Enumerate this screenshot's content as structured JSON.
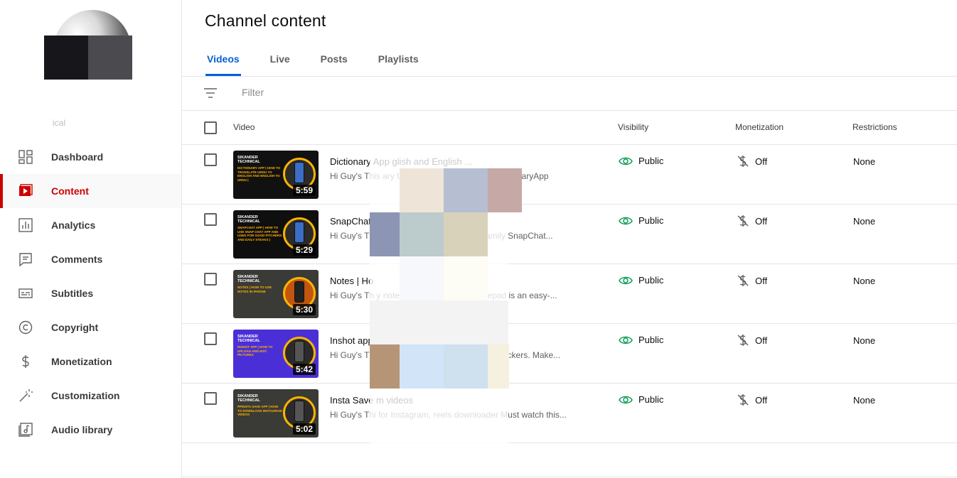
{
  "sidebar": {
    "channel_name": "ical",
    "items": [
      {
        "label": "Dashboard",
        "icon": "dashboard-icon"
      },
      {
        "label": "Content",
        "icon": "content-icon",
        "active": true
      },
      {
        "label": "Analytics",
        "icon": "analytics-icon"
      },
      {
        "label": "Comments",
        "icon": "comments-icon"
      },
      {
        "label": "Subtitles",
        "icon": "subtitles-icon"
      },
      {
        "label": "Copyright",
        "icon": "copyright-icon"
      },
      {
        "label": "Monetization",
        "icon": "dollar-icon"
      },
      {
        "label": "Customization",
        "icon": "magic-wand-icon"
      },
      {
        "label": "Audio library",
        "icon": "audio-library-icon"
      }
    ]
  },
  "main": {
    "title": "Channel content",
    "tabs": [
      {
        "label": "Videos",
        "active": true
      },
      {
        "label": "Live"
      },
      {
        "label": "Posts"
      },
      {
        "label": "Playlists"
      }
    ],
    "filter": {
      "placeholder": "Filter"
    },
    "columns": {
      "video": "Video",
      "visibility": "Visibility",
      "monetization": "Monetization",
      "restrictions": "Restrictions"
    },
    "accent_color": "#065fd4",
    "active_nav_color": "#cc0000",
    "visibility_color": "#0f9d58"
  },
  "videos": [
    {
      "title": "Dictionary App glish and English ...",
      "description": "Hi Guy's This ary Urdu to English & English to nionaryApp",
      "duration": "5:59",
      "thumb_brand": "SIKANDER TECHNICAL",
      "thumb_text": "DICTIONARY APP | HOW TO TRANSLATE URDU TO ENGLISH AND ENGLISH TO URDU |",
      "visibility": "Public",
      "monetization": "Off",
      "restrictions": "None"
    },
    {
      "title": "SnapChat A nd used for good ...",
      "description": "Hi Guy's Thi nd entertaining way to shar family SnapChat...",
      "duration": "5:29",
      "thumb_brand": "SIKANDER TECHNICAL",
      "thumb_text": "SNAPCHAT APP | HOW TO USE SNAP CHAT APP AND USED FOR GOOD PITCHERS AND DAILY STEAKS |",
      "visibility": "Public",
      "monetization": "Off",
      "restrictions": "None"
    },
    {
      "title": "Notes | Ho",
      "description": "Hi Guy's Th y notebook for notes, to-do otepad is an easy-...",
      "duration": "5:30",
      "thumb_brand": "SIKANDER TECHNICAL",
      "thumb_text": "NOTES | HOW TO USE NOTES IN IPHONE",
      "visibility": "Public",
      "monetization": "Off",
      "restrictions": "None"
    },
    {
      "title": "Inshot app s",
      "description": "Hi Guy's Th oto editor. Edit pictures and and stickers. Make...",
      "duration": "5:42",
      "thumb_brand": "SIKANDER TECHNICAL",
      "thumb_text": "INSHOT APP | HOW TO UPLOAD AND EDIT PICTURES",
      "visibility": "Public",
      "monetization": "Off",
      "restrictions": "None"
    },
    {
      "title": "Insta Save m videos",
      "description": "Hi Guy's Thi for Instagram, reels downloader Must watch this...",
      "duration": "5:02",
      "thumb_brand": "SIKANDER TECHNICAL",
      "thumb_text": "PPINSTA SAVE APP | HOW TO DOWNLOAD INSTAGRAM VIDEOS",
      "visibility": "Public",
      "monetization": "Off",
      "restrictions": "None"
    }
  ]
}
